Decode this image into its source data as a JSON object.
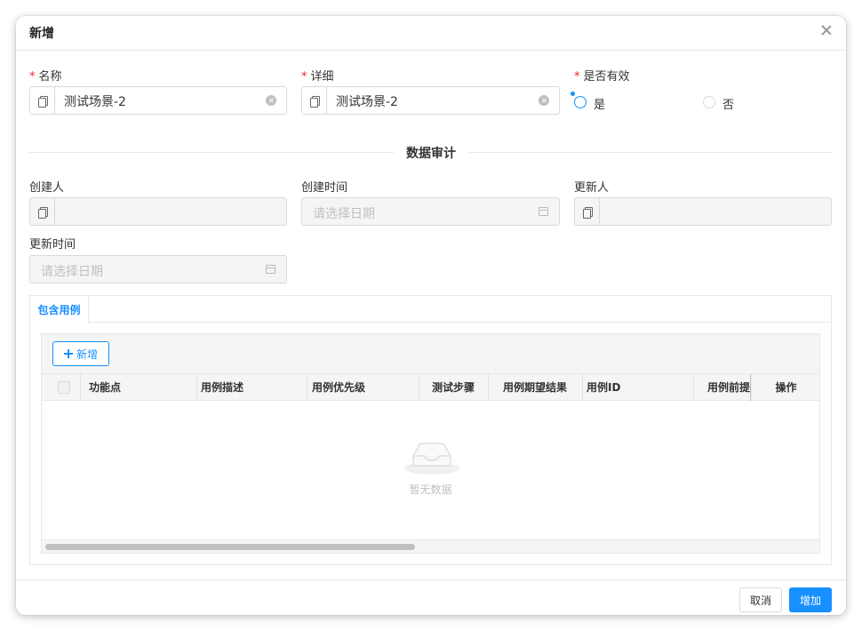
{
  "dialog": {
    "title": "新增",
    "close": "×"
  },
  "form": {
    "name": {
      "label": "名称",
      "value": "测试场景-2"
    },
    "detail": {
      "label": "详细",
      "value": "测试场景-2"
    },
    "valid": {
      "label": "是否有效",
      "options": [
        "是",
        "否"
      ],
      "selected": "是"
    },
    "required_mark": "*"
  },
  "audit": {
    "divider_title": "数据审计",
    "creator": {
      "label": "创建人",
      "value": ""
    },
    "created_at": {
      "label": "创建时间",
      "placeholder": "请选择日期"
    },
    "updater": {
      "label": "更新人",
      "value": ""
    },
    "updated_at": {
      "label": "更新时间",
      "placeholder": "请选择日期"
    }
  },
  "tabs": {
    "items": [
      "包含用例"
    ],
    "active": "包含用例"
  },
  "table": {
    "add_label": "新增",
    "columns": [
      "功能点",
      "用例描述",
      "用例优先级",
      "测试步骤",
      "用例期望结果",
      "用例ID",
      "用例前提",
      "操作"
    ],
    "empty_text": "暂无数据"
  },
  "footer": {
    "cancel_label": "取消",
    "ok_label": "增加"
  },
  "colors": {
    "primary": "#1890ff",
    "required": "#f5222d",
    "border": "#d9d9d9",
    "disabled_bg": "#f5f5f5"
  }
}
